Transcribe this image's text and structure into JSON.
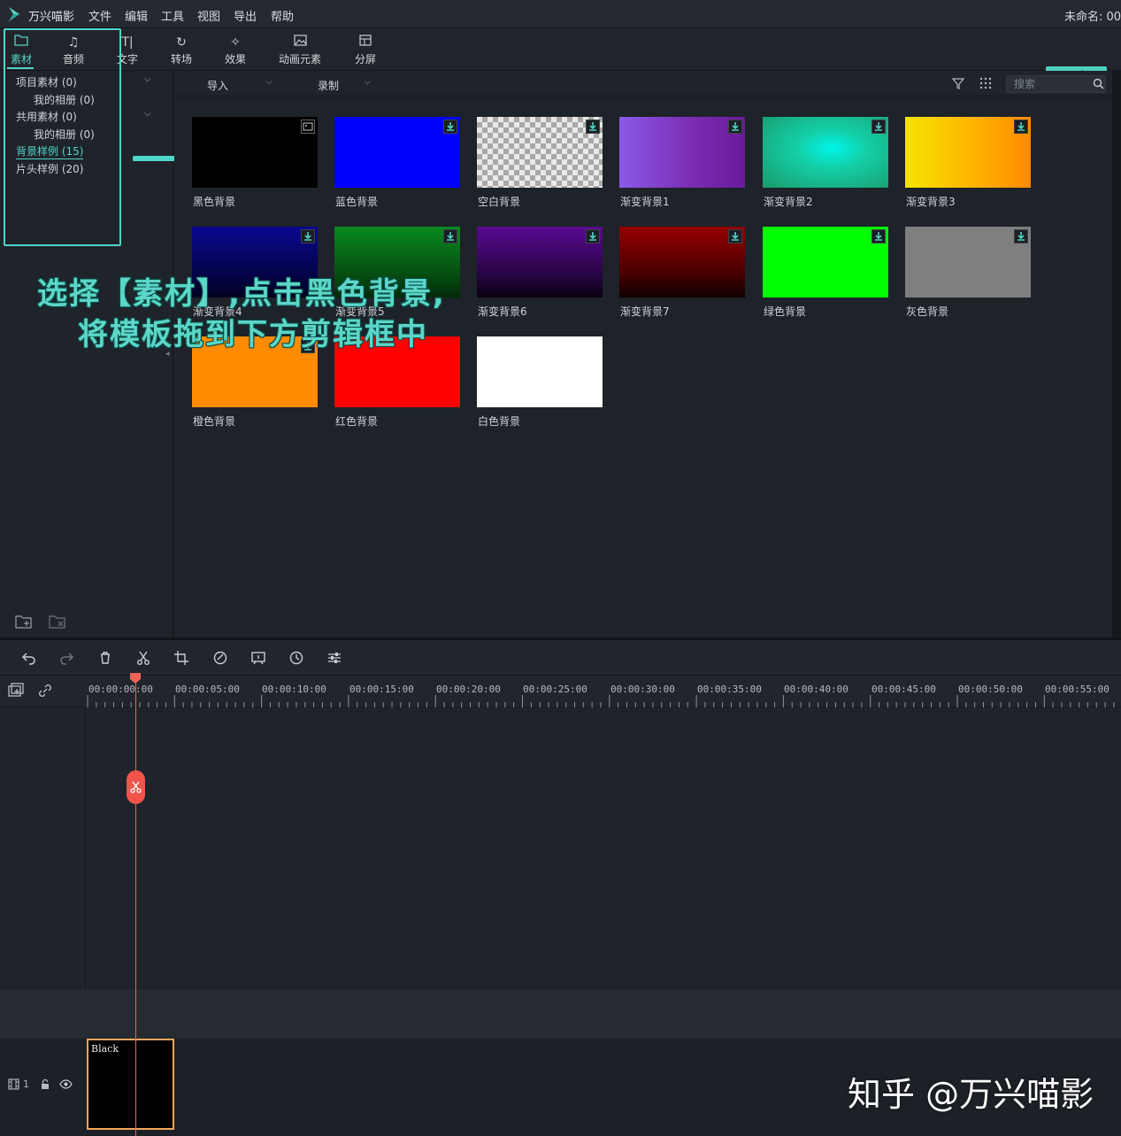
{
  "app": {
    "name": "万兴喵影",
    "project_title": "未命名: 00"
  },
  "menu": [
    "文件",
    "编辑",
    "工具",
    "视图",
    "导出",
    "帮助"
  ],
  "tabs": [
    {
      "label": "素材",
      "icon": "folder-icon"
    },
    {
      "label": "音频",
      "icon": "music-note-icon"
    },
    {
      "label": "文字",
      "icon": "text-icon"
    },
    {
      "label": "转场",
      "icon": "transition-icon"
    },
    {
      "label": "效果",
      "icon": "effect-icon"
    },
    {
      "label": "动画元素",
      "icon": "image-icon"
    },
    {
      "label": "分屏",
      "icon": "split-screen-icon"
    }
  ],
  "export_label": "导出",
  "sidebar": {
    "items": [
      {
        "label": "项目素材 (0)"
      },
      {
        "label": "我的相册 (0)"
      },
      {
        "label": "共用素材 (0)"
      },
      {
        "label": "我的相册 (0)"
      },
      {
        "label": "背景样例 (15)"
      },
      {
        "label": "片头样例 (20)"
      }
    ]
  },
  "media_toolbar": {
    "import_label": "导入",
    "record_label": "录制",
    "search_placeholder": "搜索"
  },
  "media": [
    {
      "label": "黑色背景",
      "color": "#000000"
    },
    {
      "label": "蓝色背景",
      "color": "#0000ff"
    },
    {
      "label": "空白背景",
      "color": "checker"
    },
    {
      "label": "渐变背景1",
      "color": "#8a4fe0"
    },
    {
      "label": "渐变背景2",
      "color": "#19c79a"
    },
    {
      "label": "渐变背景3",
      "color": "#ffcc00"
    },
    {
      "label": "渐变背景4",
      "color": "#06056b"
    },
    {
      "label": "渐变背景5",
      "color": "#0a7a1c"
    },
    {
      "label": "渐变背景6",
      "color": "#4a0a7a"
    },
    {
      "label": "渐变背景7",
      "color": "#8a0000"
    },
    {
      "label": "绿色背景",
      "color": "#00ff00"
    },
    {
      "label": "灰色背景",
      "color": "#7f7f7f"
    },
    {
      "label": "橙色背景",
      "color": "#ff8c00"
    },
    {
      "label": "红色背景",
      "color": "#ff0000"
    },
    {
      "label": "白色背景",
      "color": "#ffffff"
    }
  ],
  "caption": {
    "line1": "选择【素材】,点击黑色背景,",
    "line2": "将模板拖到下方剪辑框中"
  },
  "timeline": {
    "ticks": [
      "00:00:00:00",
      "00:00:05:00",
      "00:00:10:00",
      "00:00:15:00",
      "00:00:20:00",
      "00:00:25:00",
      "00:00:30:00",
      "00:00:35:00",
      "00:00:40:00",
      "00:00:45:00",
      "00:00:50:00",
      "00:00:55:00"
    ],
    "track_number": "1",
    "clip_label": "Black"
  },
  "watermark": "知乎 @万兴喵影"
}
